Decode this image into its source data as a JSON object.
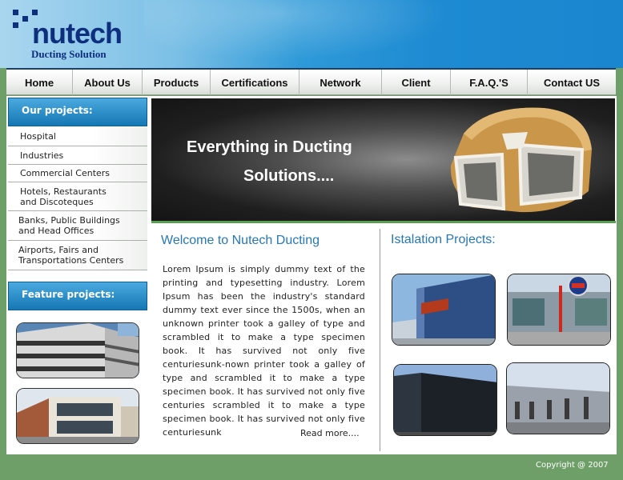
{
  "brand": {
    "name": "nutech",
    "tagline": "Ducting Solution"
  },
  "nav": {
    "items": [
      "Home",
      "About Us",
      "Products",
      "Certifications",
      "Network",
      "Client",
      "F.A.Q.'S",
      "Contact US"
    ]
  },
  "sidebar": {
    "projects_heading": "Our projects:",
    "project_items": [
      "Hospital",
      "Industries",
      "Commercial Centers",
      "Hotels, Restaurants\nand Discoteques",
      "Banks, Public Buildings\nand Head Offices",
      "Airports, Fairs and\nTransportations Centers"
    ],
    "feature_heading": "Feature projects:"
  },
  "banner": {
    "line1": "Everything in Ducting",
    "line2": "Solutions...."
  },
  "welcome": {
    "title": "Welcome to Nutech Ducting",
    "body": "Lorem Ipsum is simply dummy text of the printing and typesetting industry. Lorem Ipsum has been the industry's standard dummy text ever since the 1500s, when an unknown printer took a galley of type and scrambled it to make a type specimen book. It has survived not only five centuriesunk-nown printer took a galley of type and scrambled it to make a type specimen book. It has survived not only five centuries scrambled it to make a type specimen book. It has survived not only five centuriesunk",
    "read_more": "Read more...."
  },
  "installation": {
    "title": "Istalation Projects:"
  },
  "footer": {
    "copyright": "Copyright @ 2007"
  },
  "colors": {
    "accent": "#2478b6",
    "brand": "#0e2f7d",
    "background": "#6f9f68"
  }
}
